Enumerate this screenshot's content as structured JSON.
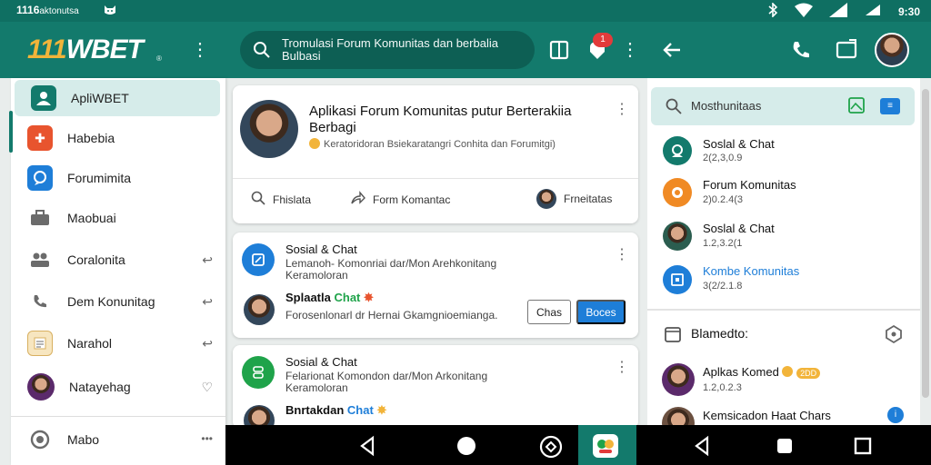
{
  "status": {
    "time_left": "1116",
    "time_left_suffix": "aktonutsa",
    "time_right": "9:30"
  },
  "app": {
    "logo_num": "111",
    "logo_text": "WBET",
    "logo_sub": "®",
    "search_text": "Tromulasi Forum Komunitas dan berbalia Bulbasi"
  },
  "notifications": {
    "count": "1"
  },
  "drawer": {
    "items": [
      {
        "label": "ApliWBET",
        "icon": "people-icon",
        "color": "#137a6c"
      },
      {
        "label": "Habebia",
        "icon": "plus-icon",
        "color": "#e8542e"
      },
      {
        "label": "Forumimita",
        "icon": "chat-icon",
        "color": "#1e7ed8"
      },
      {
        "label": "Maobuai",
        "icon": "briefcase-icon",
        "color": "#6b6b6b"
      },
      {
        "label": "Coralonita",
        "icon": "group-icon",
        "color": "#6b6b6b"
      },
      {
        "label": "Dem Konunitag",
        "icon": "phone-icon",
        "color": "#6b6b6b"
      },
      {
        "label": "Narahol",
        "icon": "document-icon",
        "color": "#f2b43a"
      },
      {
        "label": "Natayehag",
        "icon": "avatar",
        "color": "#3d2a1e"
      },
      {
        "label": "Mabo",
        "icon": "settings-icon",
        "color": "#6b6b6b"
      }
    ]
  },
  "post": {
    "title": "Aplikasi Forum Komunitas putur Berterakiia Berbagi",
    "subtitle": "Keratoridoran Bsiekaratangri Conhita dan Forumitgi)",
    "actions": {
      "search": "Fhislata",
      "share": "Form Komantac",
      "profile": "Frneitatas"
    }
  },
  "feed": [
    {
      "title": "Sosial & Chat",
      "text": "Lemanoh- Komonriai dar/Mon Arehkonitang Keramoloran",
      "chat_name": "Splaatla",
      "chat_tag": "Chat",
      "chat_text": "Forosenlonarl dr Hernai Gkamgnioemianga.",
      "btn_outline": "Chas",
      "btn_fill": "Boces"
    },
    {
      "title": "Sosial & Chat",
      "text": "Felarionat Komondon dar/Mon Arkonitang Keramoloran",
      "chat_name": "Bnrtakdan",
      "chat_tag": "Chat"
    }
  ],
  "right": {
    "search_text": "Mosthunitaas",
    "items": [
      {
        "title": "Soslal & Chat",
        "sub": "2(2,3,0.9",
        "color": "#137a6c"
      },
      {
        "title": "Forum Komunitas",
        "sub": "2)0.2.4(3",
        "color": "#f08a24"
      },
      {
        "title": "Soslal & Chat",
        "sub": "1.2,3.2(1",
        "color": "#3d2a1e"
      },
      {
        "title": "Kombe Komunitas",
        "sub": "3(2/2.1.8",
        "color": "#1e7ed8"
      }
    ],
    "section_title": "Blamedto:",
    "section_items": [
      {
        "title": "Aplkas Komed",
        "tag": "2DD",
        "sub": "1.2,0.2.3"
      },
      {
        "title": "Kemsicadon Haat Chars",
        "sub": ""
      }
    ]
  }
}
